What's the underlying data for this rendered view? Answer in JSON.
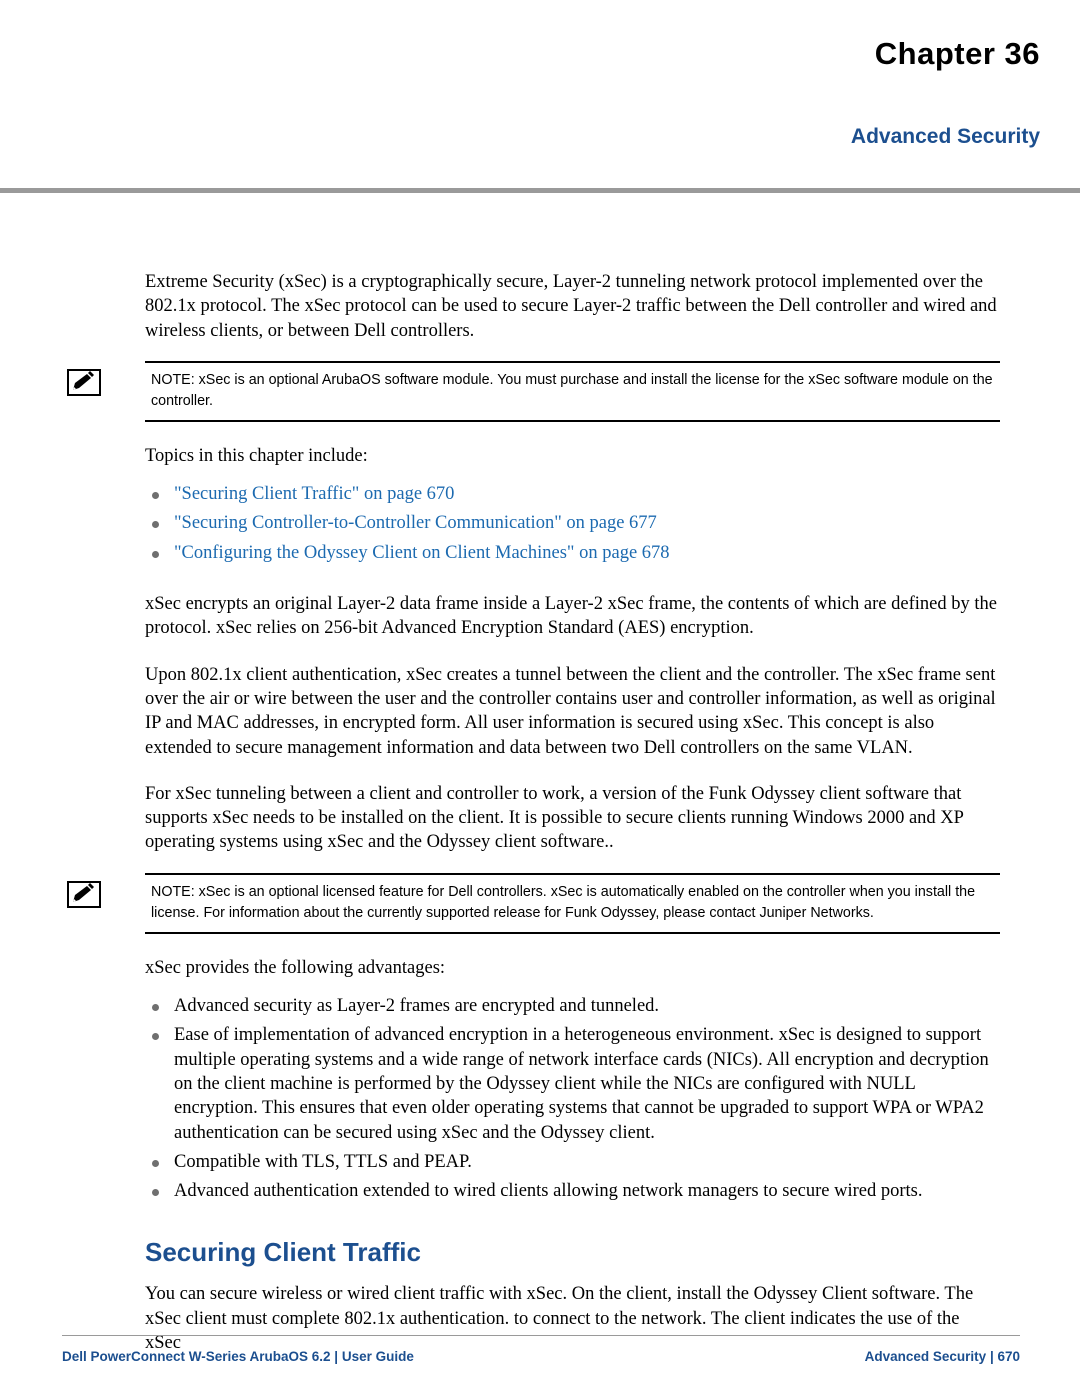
{
  "header": {
    "chapter": "Chapter 36",
    "subtitle": "Advanced Security"
  },
  "body": {
    "intro": "Extreme Security (xSec) is a cryptographically secure, Layer-2 tunneling network protocol implemented over the 802.1x protocol. The xSec protocol can be used to secure Layer-2 traffic between the Dell  controller and wired and wireless clients, or between Dell controllers.",
    "note1": "NOTE: xSec is an optional ArubaOS software module. You must purchase and install the license for the xSec software module on the controller.",
    "topics_lead": "Topics in this chapter include:",
    "topics": [
      "\"Securing Client Traffic\" on page 670",
      "\"Securing Controller-to-Controller Communication\" on page 677",
      "\"Configuring the Odyssey Client on Client Machines\" on page 678"
    ],
    "para2": "xSec encrypts an original Layer-2 data frame inside a Layer-2 xSec frame, the contents of which are defined by the protocol. xSec relies on 256-bit Advanced Encryption Standard (AES) encryption.",
    "para3": "Upon 802.1x client authentication, xSec creates a tunnel between the client and the controller. The xSec frame sent over the air or wire between the user and the controller contains user and controller information, as well as original IP and MAC addresses, in encrypted form. All user information is secured using xSec. This concept is also extended to secure management information and data between two Dell controllers on the same VLAN.",
    "para4": "For xSec tunneling between a client and controller to work, a version of the Funk Odyssey client software that supports xSec needs to be installed on the client. It is possible to secure clients running Windows 2000 and XP operating systems using xSec and the Odyssey client software..",
    "note2": "NOTE: xSec is an optional licensed feature for  Dell controllers. xSec is automatically enabled on the controller when you install the license. For information about the currently supported release for Funk Odyssey, please contact Juniper Networks.",
    "advantages_lead": "xSec provides the following advantages:",
    "advantages": [
      "Advanced security as Layer-2 frames are encrypted and tunneled.",
      "Ease of implementation of advanced encryption in a heterogeneous environment. xSec is designed to support multiple operating systems and a wide range of network interface cards (NICs). All encryption and decryption on the client machine is performed by the Odyssey client while the NICs are configured with NULL encryption. This ensures that even older operating systems that cannot be upgraded to support WPA or WPA2 authentication can be secured using xSec and the Odyssey client.",
      "Compatible with TLS, TTLS and PEAP.",
      "Advanced authentication extended to wired clients allowing network managers to secure wired ports."
    ],
    "section_heading": "Securing Client Traffic",
    "section_para": "You can secure wireless or wired client traffic with xSec. On the client, install the Odyssey Client software. The xSec client must complete 802.1x authentication. to connect to the network. The client indicates the use of the xSec"
  },
  "footer": {
    "left": "Dell PowerConnect W-Series ArubaOS 6.2 | User Guide",
    "right": "Advanced Security | 670"
  }
}
